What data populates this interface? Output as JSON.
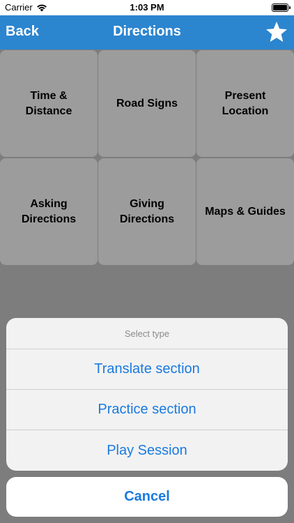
{
  "status_bar": {
    "carrier": "Carrier",
    "time": "1:03 PM",
    "icons": [
      "wifi-icon",
      "battery-icon"
    ]
  },
  "nav": {
    "back_label": "Back",
    "title": "Directions",
    "favorite_icon": "star-icon",
    "color": "#2c85cf"
  },
  "tiles": [
    {
      "label": "Time &\nDistance"
    },
    {
      "label": "Road Signs"
    },
    {
      "label": "Present\nLocation"
    },
    {
      "label": "Asking\nDirections"
    },
    {
      "label": "Giving\nDirections"
    },
    {
      "label": "Maps & Guides"
    }
  ],
  "action_sheet": {
    "header": "Select type",
    "options": [
      {
        "label": "Translate section"
      },
      {
        "label": "Practice section"
      },
      {
        "label": "Play Session"
      }
    ],
    "cancel_label": "Cancel",
    "accent_color": "#1a7ae0"
  }
}
